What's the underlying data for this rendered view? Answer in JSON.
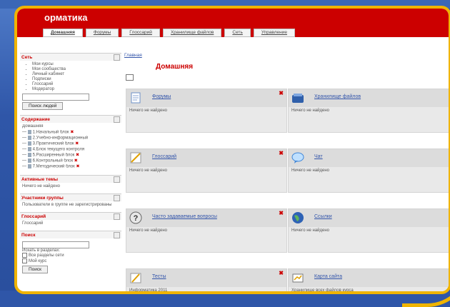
{
  "header": {
    "app_title": "орматика",
    "tabs": [
      "Домашняя",
      "Форумы",
      "Глоссарий",
      "Хранилище файлов",
      "Сеть",
      "Управление"
    ]
  },
  "sidebar": {
    "network": {
      "title": "Сеть",
      "items": [
        "Мои курсы",
        "Мои сообщества",
        "Личный кабинет",
        "Подписки",
        "Глоссарий",
        "Модератор"
      ],
      "button": "Поиск людей"
    },
    "contents": {
      "title": "Содержание",
      "root": "Домашняя",
      "items": [
        "1.Начальный блок",
        "2.Учебно-информационный",
        "3.Практический блок",
        "4.Блок текущего контроля",
        "5.Расширенный блок",
        "6.Контрольный блок",
        "7.Методический блок"
      ]
    },
    "topics": {
      "title": "Активные темы",
      "text": "Ничего не найдено"
    },
    "group": {
      "title": "Участники группы",
      "text": "Пользователи в группе не зарегистрированы"
    },
    "glossary": {
      "title": "Глоссарий",
      "text": "Глоссарий"
    },
    "search": {
      "title": "Поиск",
      "label": "Искать в разделах:",
      "opt1": "Все разделы сети",
      "opt2": "Мой курс",
      "button": "Поиск"
    }
  },
  "main": {
    "breadcrumb": "Главная",
    "title": "Домашняя",
    "cards": [
      {
        "title": "Форумы",
        "body": "Ничего не найдено",
        "icon": "doc-icon"
      },
      {
        "title": "Хранилище файлов",
        "body": "Ничего не найдено",
        "icon": "files-icon"
      },
      {
        "title": "Глоссарий",
        "body": "Ничего не найдено",
        "icon": "glossary-icon"
      },
      {
        "title": "Чат",
        "body": "Ничего не найдено",
        "icon": "chat-icon"
      },
      {
        "title": "Часто задаваемые вопросы",
        "body": "Ничего не найдено",
        "icon": "question-icon"
      },
      {
        "title": "Ссылки",
        "body": "Ничего не найдено",
        "icon": "globe-icon"
      },
      {
        "title": "Тесты",
        "body": "Информатика 2011",
        "icon": "test-icon"
      },
      {
        "title": "Карта сайта",
        "body": "Хранилище всех файлов курса",
        "icon": "sitemap-icon"
      }
    ]
  },
  "colors": {
    "header_red": "#cc0000",
    "frame_gold": "#f0b400",
    "background_blue": "#2f56a8"
  }
}
